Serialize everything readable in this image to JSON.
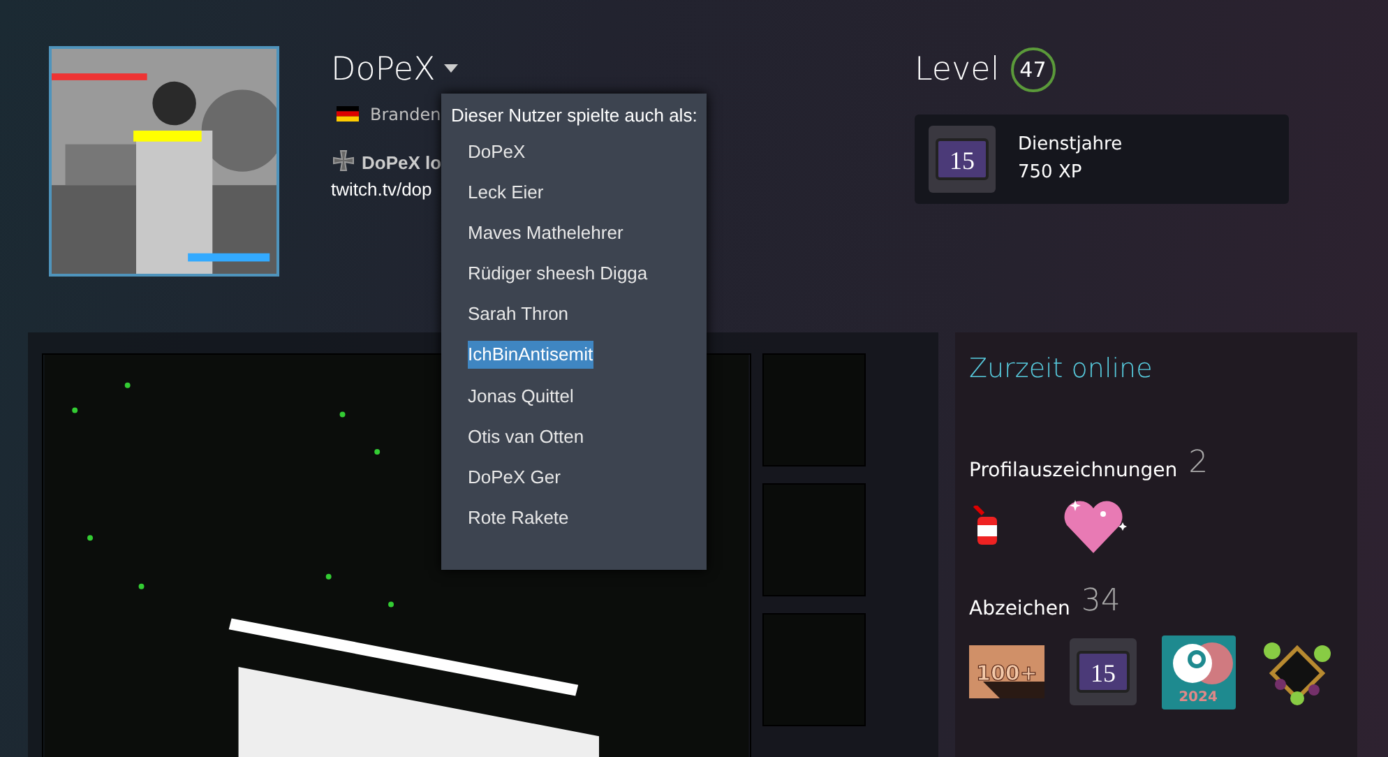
{
  "profile": {
    "name": "DoPeX",
    "location": "Branden",
    "summary_line": "DoPeX lo",
    "link": "twitch.tv/dop"
  },
  "alias_menu": {
    "heading": "Dieser Nutzer spielte auch als:",
    "items": [
      {
        "label": "DoPeX",
        "selected": false
      },
      {
        "label": "Leck Eier",
        "selected": false
      },
      {
        "label": "Maves Mathelehrer",
        "selected": false
      },
      {
        "label": "Rüdiger sheesh Digga",
        "selected": false
      },
      {
        "label": "Sarah Thron",
        "selected": false
      },
      {
        "label": "IchBinAntisemit",
        "selected": true
      },
      {
        "label": "Jonas Quittel",
        "selected": false
      },
      {
        "label": "Otis van Otten",
        "selected": false
      },
      {
        "label": "DoPeX Ger",
        "selected": false
      },
      {
        "label": "Rote Rakete",
        "selected": false
      }
    ]
  },
  "level": {
    "label": "Level",
    "value": "47",
    "badge": {
      "number": "15",
      "title": "Dienstjahre",
      "xp": "750 XP"
    }
  },
  "status": "Zurzeit online",
  "awards": {
    "label": "Profilauszeichnungen",
    "count": "2"
  },
  "badges": {
    "label": "Abzeichen",
    "count": "34",
    "items": [
      {
        "kind": "hundred",
        "text": "100+"
      },
      {
        "kind": "years",
        "text": "15"
      },
      {
        "kind": "steam",
        "text": "2024"
      },
      {
        "kind": "vine"
      }
    ]
  }
}
